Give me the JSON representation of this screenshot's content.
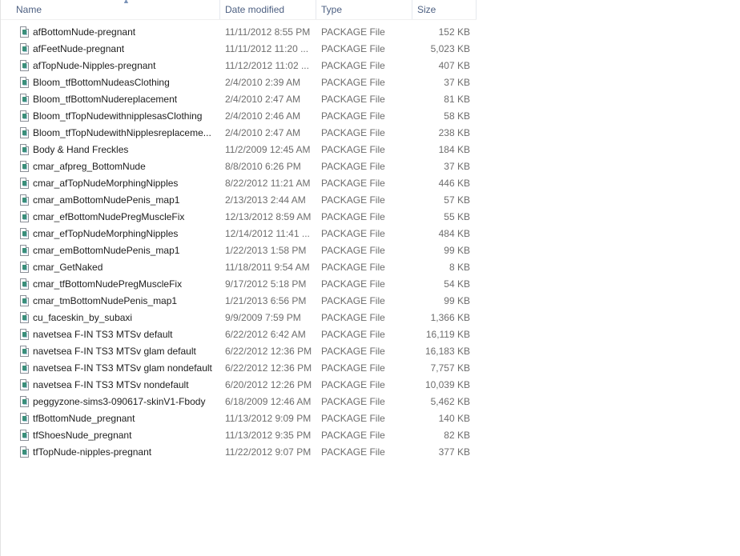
{
  "columns": {
    "name": "Name",
    "date": "Date modified",
    "type": "Type",
    "size": "Size"
  },
  "files": [
    {
      "name": "afBottomNude-pregnant",
      "date": "11/11/2012 8:55 PM",
      "type": "PACKAGE File",
      "size": "152 KB"
    },
    {
      "name": "afFeetNude-pregnant",
      "date": "11/11/2012 11:20 ...",
      "type": "PACKAGE File",
      "size": "5,023 KB"
    },
    {
      "name": "afTopNude-Nipples-pregnant",
      "date": "11/12/2012 11:02 ...",
      "type": "PACKAGE File",
      "size": "407 KB"
    },
    {
      "name": "Bloom_tfBottomNudeasClothing",
      "date": "2/4/2010 2:39 AM",
      "type": "PACKAGE File",
      "size": "37 KB"
    },
    {
      "name": "Bloom_tfBottomNudereplacement",
      "date": "2/4/2010 2:47 AM",
      "type": "PACKAGE File",
      "size": "81 KB"
    },
    {
      "name": "Bloom_tfTopNudewithnipplesasClothing",
      "date": "2/4/2010 2:46 AM",
      "type": "PACKAGE File",
      "size": "58 KB"
    },
    {
      "name": "Bloom_tfTopNudewithNipplesreplaceme...",
      "date": "2/4/2010 2:47 AM",
      "type": "PACKAGE File",
      "size": "238 KB"
    },
    {
      "name": "Body & Hand Freckles",
      "date": "11/2/2009 12:45 AM",
      "type": "PACKAGE File",
      "size": "184 KB"
    },
    {
      "name": "cmar_afpreg_BottomNude",
      "date": "8/8/2010 6:26 PM",
      "type": "PACKAGE File",
      "size": "37 KB"
    },
    {
      "name": "cmar_afTopNudeMorphingNipples",
      "date": "8/22/2012 11:21 AM",
      "type": "PACKAGE File",
      "size": "446 KB"
    },
    {
      "name": "cmar_amBottomNudePenis_map1",
      "date": "2/13/2013 2:44 AM",
      "type": "PACKAGE File",
      "size": "57 KB"
    },
    {
      "name": "cmar_efBottomNudePregMuscleFix",
      "date": "12/13/2012 8:59 AM",
      "type": "PACKAGE File",
      "size": "55 KB"
    },
    {
      "name": "cmar_efTopNudeMorphingNipples",
      "date": "12/14/2012 11:41 ...",
      "type": "PACKAGE File",
      "size": "484 KB"
    },
    {
      "name": "cmar_emBottomNudePenis_map1",
      "date": "1/22/2013 1:58 PM",
      "type": "PACKAGE File",
      "size": "99 KB"
    },
    {
      "name": "cmar_GetNaked",
      "date": "11/18/2011 9:54 AM",
      "type": "PACKAGE File",
      "size": "8 KB"
    },
    {
      "name": "cmar_tfBottomNudePregMuscleFix",
      "date": "9/17/2012 5:18 PM",
      "type": "PACKAGE File",
      "size": "54 KB"
    },
    {
      "name": "cmar_tmBottomNudePenis_map1",
      "date": "1/21/2013 6:56 PM",
      "type": "PACKAGE File",
      "size": "99 KB"
    },
    {
      "name": "cu_faceskin_by_subaxi",
      "date": "9/9/2009 7:59 PM",
      "type": "PACKAGE File",
      "size": "1,366 KB"
    },
    {
      "name": "navetsea F-IN TS3 MTSv default",
      "date": "6/22/2012 6:42 AM",
      "type": "PACKAGE File",
      "size": "16,119 KB"
    },
    {
      "name": "navetsea F-IN TS3 MTSv glam default",
      "date": "6/22/2012 12:36 PM",
      "type": "PACKAGE File",
      "size": "16,183 KB"
    },
    {
      "name": "navetsea F-IN TS3 MTSv glam nondefault",
      "date": "6/22/2012 12:36 PM",
      "type": "PACKAGE File",
      "size": "7,757 KB"
    },
    {
      "name": "navetsea F-IN TS3 MTSv nondefault",
      "date": "6/20/2012 12:26 PM",
      "type": "PACKAGE File",
      "size": "10,039 KB"
    },
    {
      "name": "peggyzone-sims3-090617-skinV1-Fbody",
      "date": "6/18/2009 12:46 AM",
      "type": "PACKAGE File",
      "size": "5,462 KB"
    },
    {
      "name": "tfBottomNude_pregnant",
      "date": "11/13/2012 9:09 PM",
      "type": "PACKAGE File",
      "size": "140 KB"
    },
    {
      "name": "tfShoesNude_pregnant",
      "date": "11/13/2012 9:35 PM",
      "type": "PACKAGE File",
      "size": "82 KB"
    },
    {
      "name": "tfTopNude-nipples-pregnant",
      "date": "11/22/2012 9:07 PM",
      "type": "PACKAGE File",
      "size": "377 KB"
    }
  ],
  "icons": {
    "file": "package-file-icon",
    "sort": "sort-ascending-icon"
  }
}
